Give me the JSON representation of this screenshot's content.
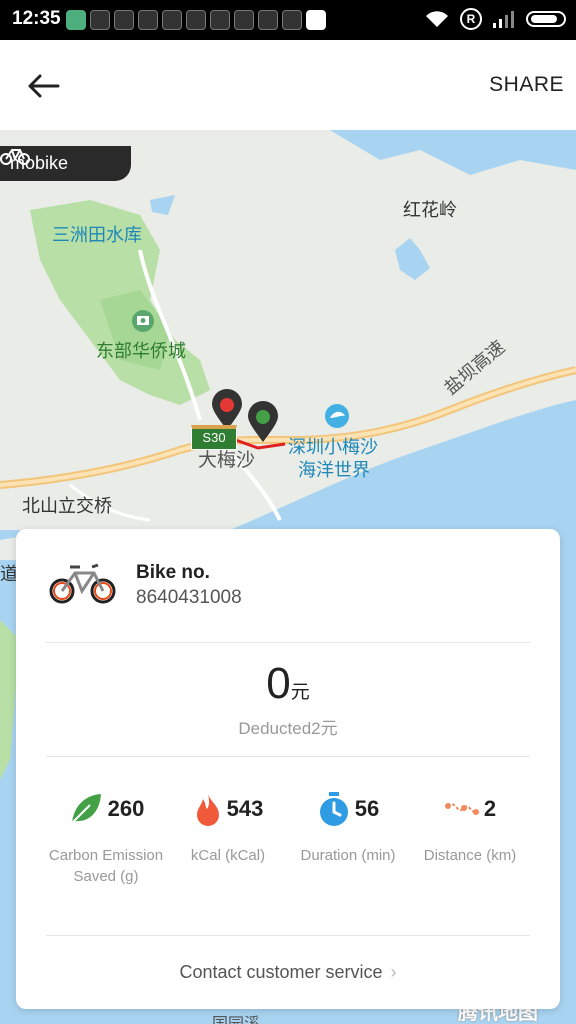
{
  "status_bar": {
    "time": "12:35",
    "registered_mark": "R"
  },
  "header": {
    "share_label": "SHARE"
  },
  "map": {
    "brand": "mobike",
    "road_code": "S30",
    "labels": {
      "sanzhou": "三洲田水库",
      "honghualing": "红花岭",
      "dongbu": "东部华侨城",
      "yanba": "盐坝高速",
      "xiaomeisha_1": "深圳小梅沙",
      "xiaomeisha_2": "海洋世界",
      "dameisha": "大梅沙",
      "beishanli": "北山立交桥",
      "dao": "道",
      "bottom": "国园溪",
      "watermark": "腾讯地图"
    }
  },
  "card": {
    "bike_title": "Bike no.",
    "bike_number": "8640431008",
    "fare_amount": "0",
    "fare_unit": "元",
    "deducted": "Deducted2元",
    "stats": [
      {
        "value": "260",
        "label": "Carbon Emission Saved (g)",
        "icon": "leaf-icon"
      },
      {
        "value": "543",
        "label": "kCal (kCal)",
        "icon": "flame-icon"
      },
      {
        "value": "56",
        "label": "Duration (min)",
        "icon": "stopwatch-icon"
      },
      {
        "value": "2",
        "label": "Distance (km)",
        "icon": "route-icon"
      }
    ],
    "contact_label": "Contact customer service"
  },
  "colors": {
    "accent": "#e64a19",
    "leaf": "#43a047",
    "flame": "#f05a3a",
    "clock": "#2f9be3",
    "route": "#f08a5d",
    "route_line": "#e02020"
  }
}
